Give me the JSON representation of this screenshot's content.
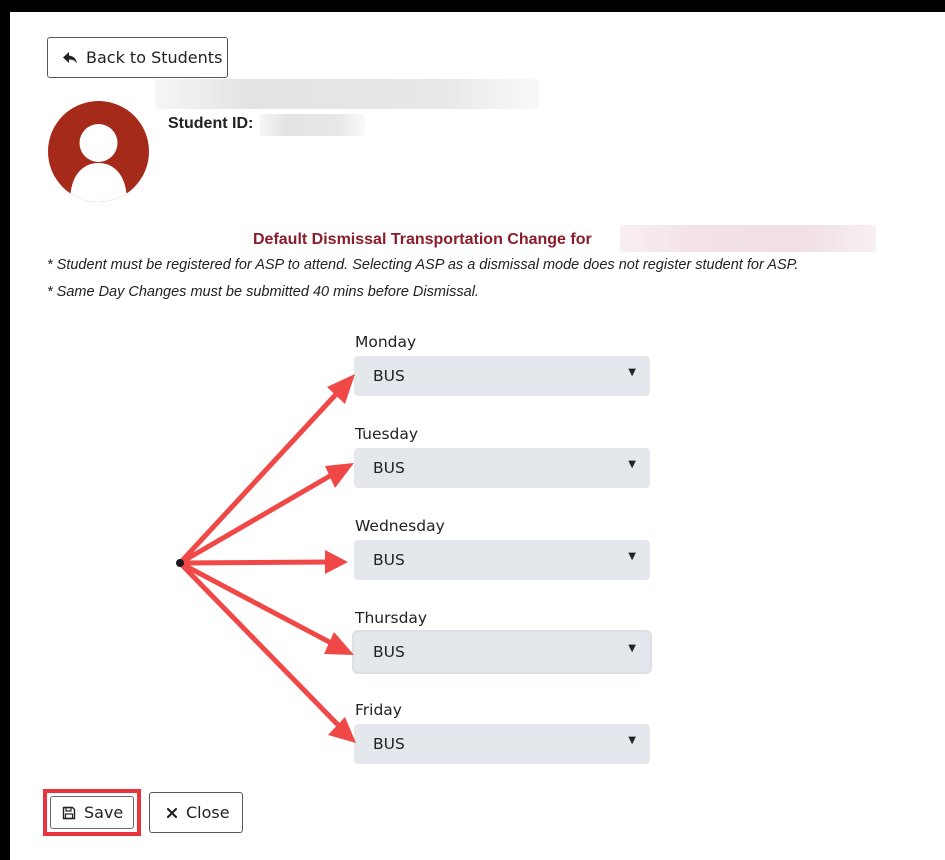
{
  "back_button": {
    "label": "Back to Students",
    "icon": "arrow-left-icon"
  },
  "student": {
    "id_label": "Student ID:",
    "avatar_color": "#a52a1a"
  },
  "form": {
    "heading": "Default Dismissal Transportation Change for",
    "heading_color": "#8a1c2b",
    "notes": [
      "* Student must be registered for ASP to attend. Selecting ASP as a dismissal mode does not register student for ASP.",
      "* Same Day Changes must be submitted 40 mins before Dismissal."
    ],
    "days": [
      {
        "label": "Monday",
        "value": "BUS"
      },
      {
        "label": "Tuesday",
        "value": "BUS"
      },
      {
        "label": "Wednesday",
        "value": "BUS"
      },
      {
        "label": "Thursday",
        "value": "BUS"
      },
      {
        "label": "Friday",
        "value": "BUS"
      }
    ]
  },
  "annotation": {
    "arrow_color": "#f04747",
    "highlight_color": "#e8343c"
  },
  "actions": {
    "save_label": "Save",
    "save_icon": "floppy-disk-icon",
    "close_label": "Close",
    "close_icon": "close-icon"
  }
}
